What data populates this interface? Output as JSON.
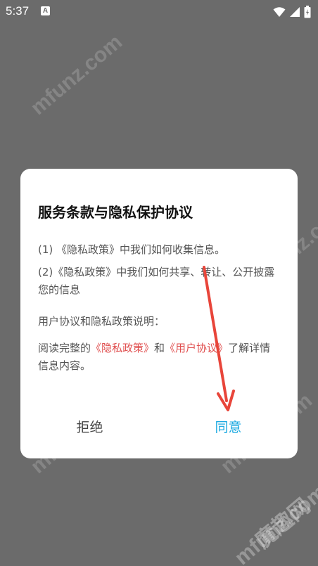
{
  "status_bar": {
    "time": "5:37",
    "notification_icon": "A"
  },
  "dialog": {
    "title": "服务条款与隐私保护协议",
    "para1": "(1) 《隐私政策》中我们如何收集信息。",
    "para2": "(2)《隐私政策》中我们如何共享、转让、公开披露您的信息",
    "para3": "用户协议和隐私政策说明：",
    "para4": {
      "before": "阅读完整的",
      "link1": "《隐私政策》",
      "middle": "和",
      "link2": "《用户协议》",
      "after": "了解详情信息内容。"
    },
    "reject_label": "拒绝",
    "agree_label": "同意"
  },
  "watermarks": [
    "mfunz.com",
    "mfunz.com",
    "mfunz.com",
    "mfunz.com",
    "mfunz.com",
    "mfunz.com",
    "魔趣网",
    "mfunz.com"
  ],
  "colors": {
    "overlay": "#6b6b6b",
    "link": "#e05050",
    "agree": "#1ba9e1",
    "arrow": "#e8453a"
  },
  "icons": [
    "wifi-icon",
    "signal-icon",
    "battery-icon",
    "arrow-annotation"
  ]
}
